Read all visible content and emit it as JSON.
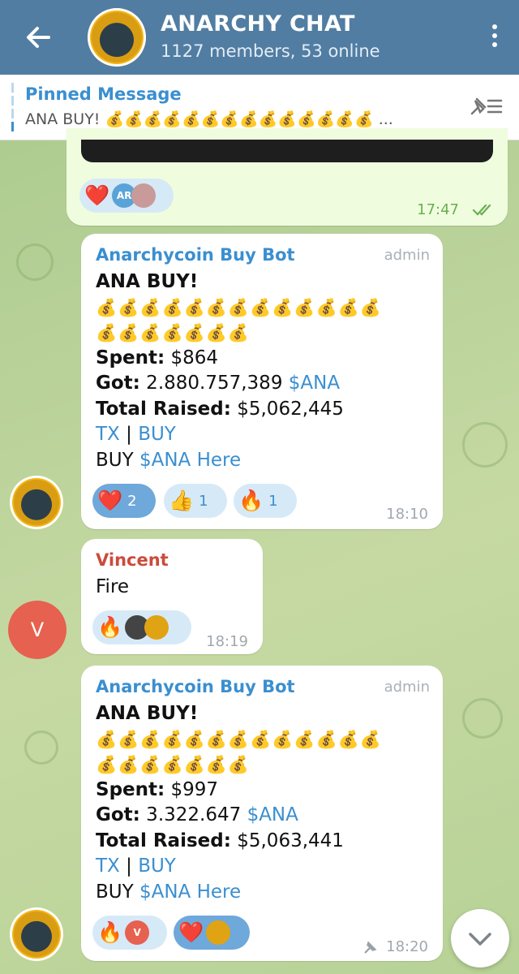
{
  "header": {
    "title": "ANARCHY CHAT",
    "subtitle": "1127 members, 53 online"
  },
  "pinned": {
    "title": "Pinned Message",
    "text": "ANA BUY! 💰💰💰💰💰💰💰💰💰💰💰💰💰💰 ..."
  },
  "messages": [
    {
      "sender": "",
      "time": "17:47",
      "outgoing": true,
      "reactions": [
        {
          "emoji": "❤️",
          "avatars": [
            "AR",
            "user-photo"
          ]
        }
      ]
    },
    {
      "sender": "Anarchycoin Buy Bot",
      "badge": "admin",
      "heading": "ANA BUY!",
      "emoji_row1": "💰💰💰💰💰💰💰💰💰💰💰💰💰",
      "emoji_row2": "💰💰💰💰💰💰💰",
      "spent_label": "Spent:",
      "spent_value": " $864",
      "got_label": "Got:",
      "got_value": " 2.880.757,389 ",
      "got_token": "$ANA",
      "raised_label": "Total Raised:",
      "raised_value": " $5,062,445",
      "tx_link": "TX",
      "sep": " | ",
      "buy_link": "BUY",
      "buy_here_prefix": "BUY ",
      "buy_here_link": "$ANA Here",
      "time": "18:10",
      "reactions": [
        {
          "emoji": "❤️",
          "count": "2",
          "selected": true
        },
        {
          "emoji": "👍",
          "count": "1",
          "selected": false
        },
        {
          "emoji": "🔥",
          "count": "1",
          "selected": false
        }
      ]
    },
    {
      "sender": "Vincent",
      "avatar_letter": "V",
      "text": "Fire",
      "time": "18:19",
      "reactions": [
        {
          "emoji": "🔥",
          "avatars": [
            "user-photo",
            "wolf-logo"
          ]
        }
      ]
    },
    {
      "sender": "Anarchycoin Buy Bot",
      "badge": "admin",
      "heading": "ANA BUY!",
      "emoji_row1": "💰💰💰💰💰💰💰💰💰💰💰💰💰",
      "emoji_row2": "💰💰💰💰💰💰💰",
      "spent_label": "Spent:",
      "spent_value": " $997",
      "got_label": "Got:",
      "got_value": " 3.322.647 ",
      "got_token": "$ANA",
      "raised_label": "Total Raised:",
      "raised_value": " $5,063,441",
      "tx_link": "TX",
      "sep": " | ",
      "buy_link": "BUY",
      "buy_here_prefix": "BUY ",
      "buy_here_link": "$ANA Here",
      "time": "18:20",
      "pinned": true,
      "reactions": [
        {
          "emoji": "🔥",
          "avatars": [
            "V"
          ]
        },
        {
          "emoji": "❤️",
          "avatars": [
            "wolf-logo"
          ],
          "selected": true
        }
      ]
    }
  ],
  "colors": {
    "header": "#517da2",
    "accent": "#3a8fd0",
    "sender_red": "#cc4b3c",
    "chat_bg": "#b9d29a"
  }
}
